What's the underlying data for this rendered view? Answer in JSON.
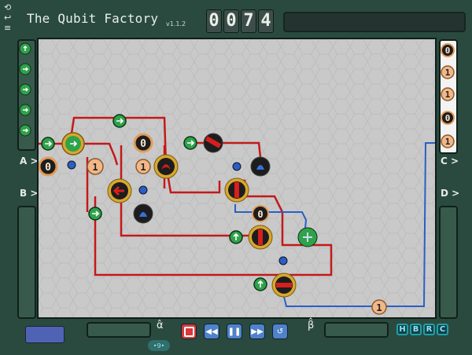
{
  "app": {
    "title": "The Qubit Factory",
    "version": "v1.1.2"
  },
  "counter": {
    "digits": [
      "0",
      "0",
      "7",
      "4"
    ]
  },
  "ports": {
    "left": [
      "A >",
      "B >"
    ],
    "right": [
      "C >",
      "D >"
    ]
  },
  "output_sequence": [
    "0",
    "1",
    "1",
    "0",
    "1"
  ],
  "board_values": {
    "source_a_left": "0",
    "source_a_right": "1",
    "source_top": "0",
    "source_mid": "1",
    "output_path_qubit": "1",
    "mid_circle_zero": "0"
  },
  "controls": {
    "greek_left": "α̂",
    "greek_right": "β̂",
    "step_label": "•9•",
    "tags": [
      "H",
      "B",
      "R",
      "C"
    ]
  },
  "colors": {
    "wire_red": "#c3191a",
    "wire_blue": "#2a5fc4",
    "board": "#c9c9c9",
    "frame": "#2a4a3f"
  }
}
